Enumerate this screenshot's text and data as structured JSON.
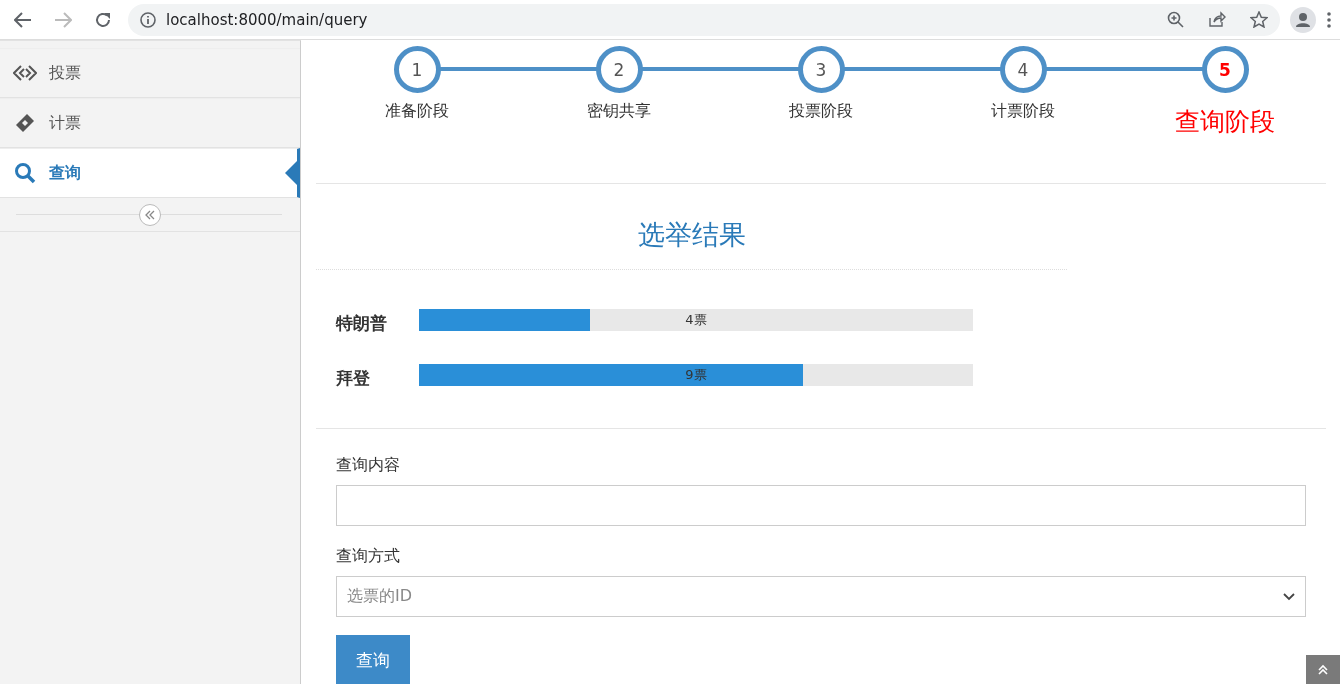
{
  "browser": {
    "url": "localhost:8000/main/query"
  },
  "sidebar": {
    "items": [
      {
        "label": "投票",
        "kind": "vote",
        "selected": false
      },
      {
        "label": "计票",
        "kind": "ticket",
        "selected": false
      },
      {
        "label": "查询",
        "kind": "search",
        "selected": true
      }
    ]
  },
  "steps": [
    {
      "number": "1",
      "label": "准备阶段",
      "selected": false
    },
    {
      "number": "2",
      "label": "密钥共享",
      "selected": false
    },
    {
      "number": "3",
      "label": "投票阶段",
      "selected": false
    },
    {
      "number": "4",
      "label": "计票阶段",
      "selected": false
    },
    {
      "number": "5",
      "label": "查询阶段",
      "selected": true
    }
  ],
  "results": {
    "title": "选举结果",
    "candidates": [
      {
        "name": "特朗普",
        "level": 0.309,
        "reading": "4票"
      },
      {
        "name": "拜登",
        "level": 0.693,
        "reading": "9票"
      }
    ]
  },
  "form": {
    "content_label": "查询内容",
    "method_label": "查询方式",
    "method_placeholder": "选票的ID",
    "submit": "查询"
  }
}
